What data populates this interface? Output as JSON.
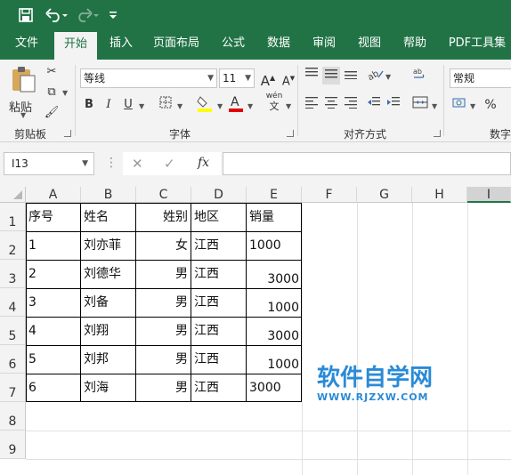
{
  "quick_access": {
    "save_icon": "save-icon",
    "undo_icon": "undo-icon",
    "redo_icon": "redo-icon",
    "customize_icon": "customize-qat-icon"
  },
  "tabs": [
    {
      "label": "文件"
    },
    {
      "label": "开始"
    },
    {
      "label": "插入"
    },
    {
      "label": "页面布局"
    },
    {
      "label": "公式"
    },
    {
      "label": "数据"
    },
    {
      "label": "审阅"
    },
    {
      "label": "视图"
    },
    {
      "label": "帮助"
    },
    {
      "label": "PDF工具集"
    }
  ],
  "ribbon": {
    "clipboard": {
      "paste_label": "粘贴",
      "group_label": "剪贴板"
    },
    "font": {
      "font_name": "等线",
      "font_size": "11",
      "grow_label": "A",
      "shrink_label": "A",
      "bold_label": "B",
      "italic_label": "I",
      "underline_label": "U",
      "phonetic_label": "wén",
      "group_label": "字体"
    },
    "alignment": {
      "group_label": "对齐方式"
    },
    "number": {
      "format": "常规",
      "percent_label": "%",
      "group_label": "数字"
    }
  },
  "formula_bar": {
    "name_box": "I13",
    "cancel_label": "✕",
    "enter_label": "✓",
    "fx_label": "fx",
    "formula": ""
  },
  "sheet": {
    "columns": [
      "A",
      "B",
      "C",
      "D",
      "E",
      "F",
      "G",
      "H",
      "I"
    ],
    "rows": [
      "1",
      "2",
      "3",
      "4",
      "5",
      "6",
      "7",
      "8",
      "9"
    ],
    "header": [
      "序号",
      "姓名",
      "姓别",
      "地区",
      "销量"
    ],
    "data": [
      [
        "1",
        "刘亦菲",
        "女",
        "江西",
        "1000"
      ],
      [
        "2",
        "刘德华",
        "男",
        "江西",
        "3000"
      ],
      [
        "3",
        "刘备",
        "男",
        "江西",
        "1000"
      ],
      [
        "4",
        "刘翔",
        "男",
        "江西",
        "3000"
      ],
      [
        "5",
        "刘邦",
        "男",
        "江西",
        "1000"
      ],
      [
        "6",
        "刘海",
        "男",
        "江西",
        "3000"
      ]
    ]
  },
  "watermark": {
    "main": "软件自学网",
    "sub": "WWW.RJZXW.COM"
  },
  "colors": {
    "excel_green": "#217346",
    "watermark_blue": "#2a8ad6"
  }
}
